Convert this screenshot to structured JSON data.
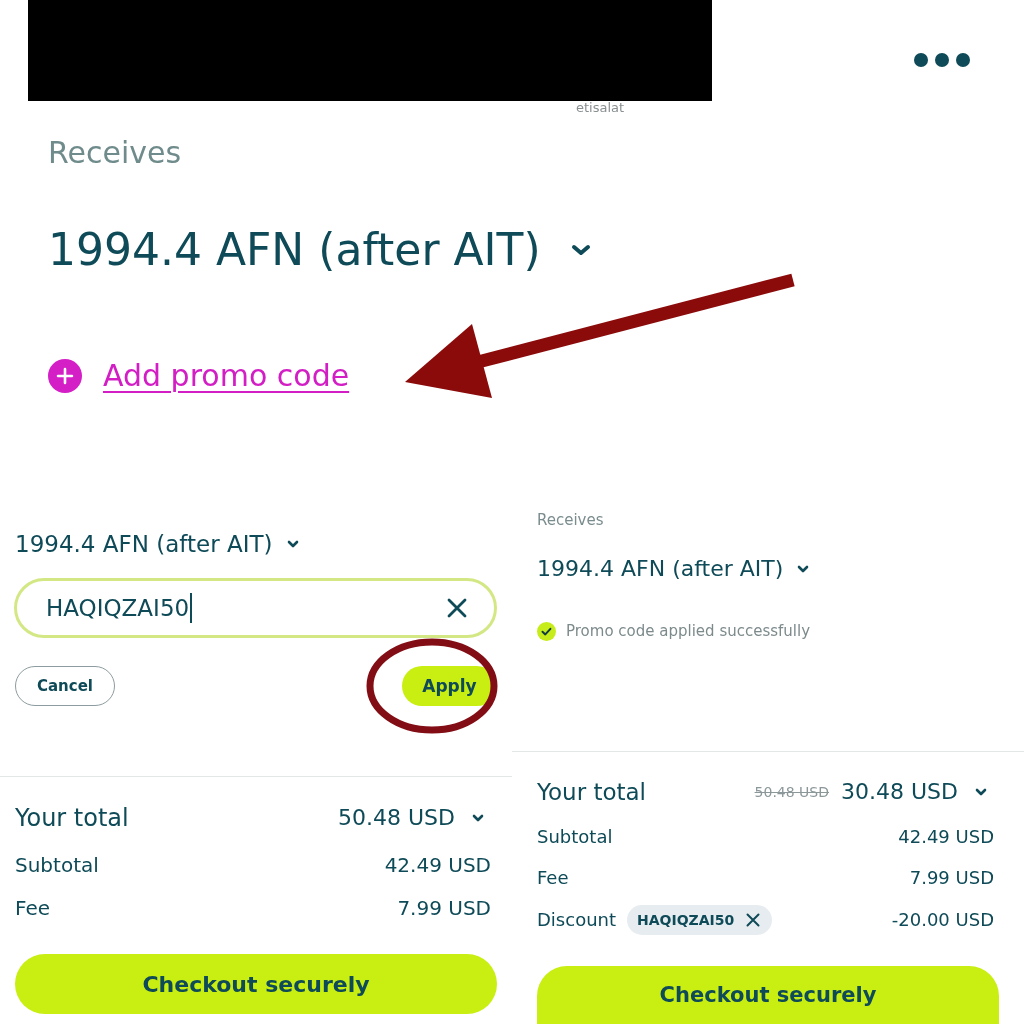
{
  "header": {
    "carrier": "etisalat"
  },
  "promo_step": {
    "label": "Receives",
    "amount": "1994.4 AFN (after AIT)",
    "promo_link": "Add promo code"
  },
  "entry_panel": {
    "amount": "1994.4 AFN (after AIT)",
    "promo_field": {
      "value": "HAQIQZAI50",
      "focused": true
    },
    "buttons": [
      {
        "label": "Cancel",
        "kind": "secondary"
      },
      {
        "label": "Apply",
        "kind": "primary"
      }
    ],
    "total": {
      "label": "Your total",
      "value": "50.48 USD"
    },
    "lines": [
      {
        "label": "Subtotal",
        "value": "42.49 USD"
      },
      {
        "label": "Fee",
        "value": "7.99 USD"
      }
    ],
    "checkout": "Checkout securely"
  },
  "applied_panel": {
    "label": "Receives",
    "amount": "1994.4 AFN (after AIT)",
    "status": {
      "kind": "success",
      "text": "Promo code applied successfully"
    },
    "total": {
      "label": "Your total",
      "old_value": "50.48 USD",
      "value": "30.48 USD"
    },
    "lines": [
      {
        "label": "Subtotal",
        "value": "42.49 USD"
      },
      {
        "label": "Fee",
        "value": "7.99 USD"
      },
      {
        "label": "Discount",
        "chip": "HAQIQZAI50",
        "value": "-20.00 USD"
      }
    ],
    "checkout": "Checkout securely"
  }
}
